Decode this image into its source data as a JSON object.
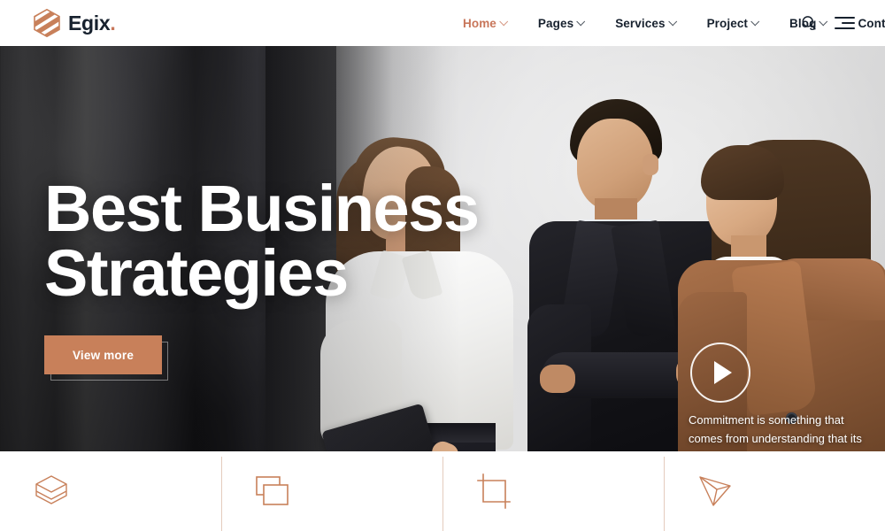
{
  "brand": {
    "name": "Egix",
    "dot": ".",
    "logo_icon": "hexagon-stripes-icon",
    "accent_color": "#c8765a",
    "text_color": "#17212e"
  },
  "nav": {
    "items": [
      {
        "label": "Home",
        "has_dropdown": true,
        "active": true
      },
      {
        "label": "Pages",
        "has_dropdown": true,
        "active": false
      },
      {
        "label": "Services",
        "has_dropdown": true,
        "active": false
      },
      {
        "label": "Project",
        "has_dropdown": true,
        "active": false
      },
      {
        "label": "Blog",
        "has_dropdown": true,
        "active": false
      },
      {
        "label": "Contact",
        "has_dropdown": false,
        "active": false
      }
    ],
    "search_icon": "search-icon",
    "menu_icon": "hamburger-menu-icon"
  },
  "hero": {
    "title": "Best Business\nStrategies",
    "cta_label": "View more",
    "cta_color": "#c8805a",
    "play_icon": "play-button-icon",
    "quote": "Commitment is something that comes from understanding that its price and then having the willingness to pay that price."
  },
  "features": {
    "divider_color": "#e4cbbd",
    "icon_color": "#c8805a",
    "items": [
      {
        "icon": "cube-box-icon"
      },
      {
        "icon": "stacked-layers-icon"
      },
      {
        "icon": "crop-frame-icon"
      },
      {
        "icon": "tetrahedron-icon"
      }
    ]
  }
}
